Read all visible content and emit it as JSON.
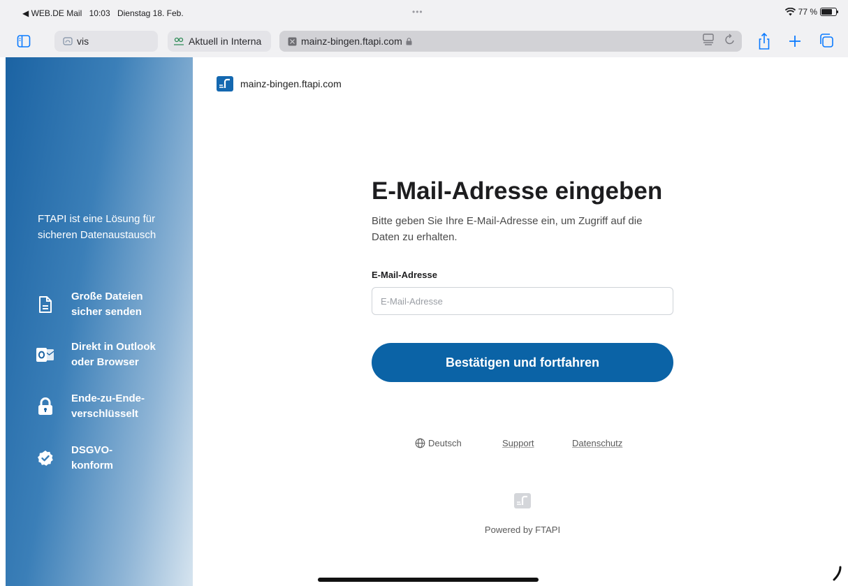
{
  "statusbar": {
    "back_app": "◀ WEB.DE Mail",
    "time": "10:03",
    "date": "Dienstag 18. Feb.",
    "dots": "•••",
    "battery": "77 %"
  },
  "tabs": [
    {
      "label": "vis"
    },
    {
      "label": "Aktuell in Interna"
    },
    {
      "label": "mainz-bingen.ftapi.com"
    }
  ],
  "left_panel": {
    "title": "FTAPI ist eine Lösung für sicheren Datenaustausch",
    "features": [
      {
        "icon": "file-icon",
        "label": "Große Dateien sicher senden"
      },
      {
        "icon": "outlook-icon",
        "label": "Direkt in Outlook oder Browser"
      },
      {
        "icon": "lock-icon",
        "label": "Ende-zu-Ende-verschlüsselt"
      },
      {
        "icon": "check-badge-icon",
        "label": "DSGVO-konform"
      }
    ]
  },
  "brand": {
    "domain": "mainz-bingen.ftapi.com"
  },
  "form": {
    "heading": "E-Mail-Adresse eingeben",
    "description": "Bitte geben Sie Ihre E-Mail-Adresse ein, um Zugriff auf die Daten zu erhalten.",
    "email_label": "E-Mail-Adresse",
    "email_placeholder": "E-Mail-Adresse",
    "email_value": "",
    "submit_label": "Bestätigen und fortfahren"
  },
  "footer": {
    "language": "Deutsch",
    "support": "Support",
    "privacy": "Datenschutz",
    "powered_by": "Powered by FTAPI"
  },
  "colors": {
    "primary": "#0b63a6",
    "panel_start": "#1b63a3",
    "panel_end": "#d6e4ef"
  }
}
